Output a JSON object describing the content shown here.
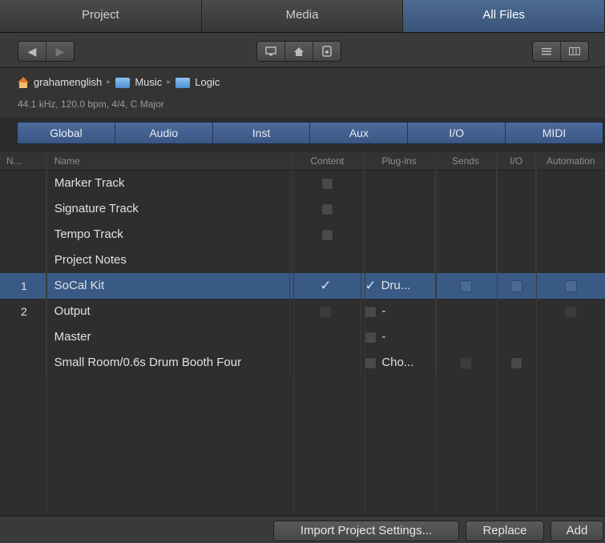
{
  "tabs": [
    "Project",
    "Media",
    "All Files"
  ],
  "active_tab": "All Files",
  "path": {
    "items": [
      "grahamenglish",
      "Music",
      "Logic"
    ],
    "info": "44.1 kHz, 120.0 bpm, 4/4, C Major"
  },
  "filters": [
    "Global",
    "Audio",
    "Inst",
    "Aux",
    "I/O",
    "MIDI"
  ],
  "columns": {
    "num": "N...",
    "name": "Name",
    "content": "Content",
    "plugins": "Plug-ins",
    "sends": "Sends",
    "io": "I/O",
    "automation": "Automation"
  },
  "rows": [
    {
      "num": "",
      "name": "Marker Track"
    },
    {
      "num": "",
      "name": "Signature Track"
    },
    {
      "num": "",
      "name": "Tempo Track"
    },
    {
      "num": "",
      "name": "Project Notes"
    },
    {
      "num": "1",
      "name": "SoCal Kit",
      "plugin": "Dru..."
    },
    {
      "num": "2",
      "name": "Output",
      "plugin": "-"
    },
    {
      "num": "",
      "name": "Master",
      "plugin": "-"
    },
    {
      "num": "",
      "name": "Small Room/0.6s Drum Booth Four",
      "plugin": "Cho..."
    }
  ],
  "buttons": {
    "import": "Import Project Settings...",
    "replace": "Replace",
    "add": "Add"
  },
  "colors": {
    "accent": "#3b5478",
    "selection": "#3a5a86"
  }
}
